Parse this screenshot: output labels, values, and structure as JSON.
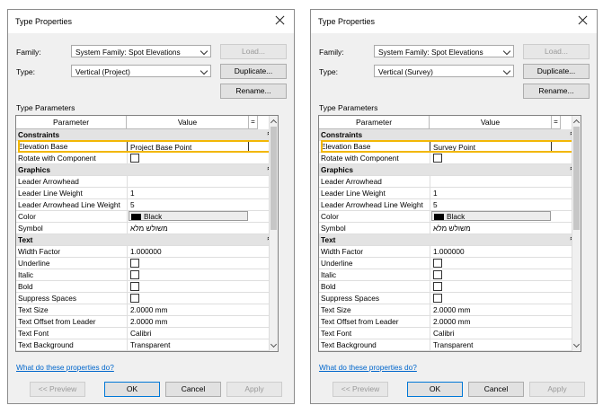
{
  "dialogs": [
    {
      "title": "Type Properties",
      "family_label": "Family:",
      "family_value": "System Family: Spot Elevations",
      "type_label": "Type:",
      "type_value": "Vertical (Project)",
      "load_label": "Load...",
      "duplicate_label": "Duplicate...",
      "rename_label": "Rename...",
      "section_label": "Type Parameters",
      "col_parameter": "Parameter",
      "col_value": "Value",
      "col_eq": "=",
      "rows": [
        {
          "kind": "group",
          "name": "Constraints"
        },
        {
          "kind": "text",
          "name": "Elevation Base",
          "value": "Project Base Point",
          "highlight": true
        },
        {
          "kind": "check",
          "name": "Rotate with Component"
        },
        {
          "kind": "group",
          "name": "Graphics"
        },
        {
          "kind": "text",
          "name": "Leader Arrowhead",
          "value": ""
        },
        {
          "kind": "text",
          "name": "Leader Line Weight",
          "value": "1"
        },
        {
          "kind": "text",
          "name": "Leader Arrowhead Line Weight",
          "value": "5"
        },
        {
          "kind": "color",
          "name": "Color",
          "value": "Black"
        },
        {
          "kind": "text",
          "name": "Symbol",
          "value": "משולש מלא"
        },
        {
          "kind": "group",
          "name": "Text"
        },
        {
          "kind": "text",
          "name": "Width Factor",
          "value": "1.000000"
        },
        {
          "kind": "check",
          "name": "Underline"
        },
        {
          "kind": "check",
          "name": "Italic"
        },
        {
          "kind": "check",
          "name": "Bold"
        },
        {
          "kind": "check",
          "name": "Suppress Spaces"
        },
        {
          "kind": "text",
          "name": "Text Size",
          "value": "2.0000 mm"
        },
        {
          "kind": "text",
          "name": "Text Offset from Leader",
          "value": "2.0000 mm"
        },
        {
          "kind": "text",
          "name": "Text Font",
          "value": "Calibri"
        },
        {
          "kind": "text",
          "name": "Text Background",
          "value": "Transparent"
        }
      ],
      "help_link": "What do these properties do?",
      "preview_label": "<< Preview",
      "ok_label": "OK",
      "cancel_label": "Cancel",
      "apply_label": "Apply"
    },
    {
      "title": "Type Properties",
      "family_label": "Family:",
      "family_value": "System Family: Spot Elevations",
      "type_label": "Type:",
      "type_value": "Vertical (Survey)",
      "load_label": "Load...",
      "duplicate_label": "Duplicate...",
      "rename_label": "Rename...",
      "section_label": "Type Parameters",
      "col_parameter": "Parameter",
      "col_value": "Value",
      "col_eq": "=",
      "rows": [
        {
          "kind": "group",
          "name": "Constraints"
        },
        {
          "kind": "text",
          "name": "Elevation Base",
          "value": "Survey Point",
          "highlight": true
        },
        {
          "kind": "check",
          "name": "Rotate with Component"
        },
        {
          "kind": "group",
          "name": "Graphics"
        },
        {
          "kind": "text",
          "name": "Leader Arrowhead",
          "value": ""
        },
        {
          "kind": "text",
          "name": "Leader Line Weight",
          "value": "1"
        },
        {
          "kind": "text",
          "name": "Leader Arrowhead Line Weight",
          "value": "5"
        },
        {
          "kind": "color",
          "name": "Color",
          "value": "Black"
        },
        {
          "kind": "text",
          "name": "Symbol",
          "value": "משולש מלא"
        },
        {
          "kind": "group",
          "name": "Text"
        },
        {
          "kind": "text",
          "name": "Width Factor",
          "value": "1.000000"
        },
        {
          "kind": "check",
          "name": "Underline"
        },
        {
          "kind": "check",
          "name": "Italic"
        },
        {
          "kind": "check",
          "name": "Bold"
        },
        {
          "kind": "check",
          "name": "Suppress Spaces"
        },
        {
          "kind": "text",
          "name": "Text Size",
          "value": "2.0000 mm"
        },
        {
          "kind": "text",
          "name": "Text Offset from Leader",
          "value": "2.0000 mm"
        },
        {
          "kind": "text",
          "name": "Text Font",
          "value": "Calibri"
        },
        {
          "kind": "text",
          "name": "Text Background",
          "value": "Transparent"
        }
      ],
      "help_link": "What do these properties do?",
      "preview_label": "<< Preview",
      "ok_label": "OK",
      "cancel_label": "Cancel",
      "apply_label": "Apply"
    }
  ],
  "colors": {
    "highlight": "#f2b705",
    "link": "#0066cc",
    "group_bg": "#e3e3e3"
  },
  "icons": {
    "close": "close-icon",
    "collapse": "chevron-up-double-icon",
    "scroll_up": "arrow-up-icon",
    "scroll_down": "arrow-down-icon"
  }
}
